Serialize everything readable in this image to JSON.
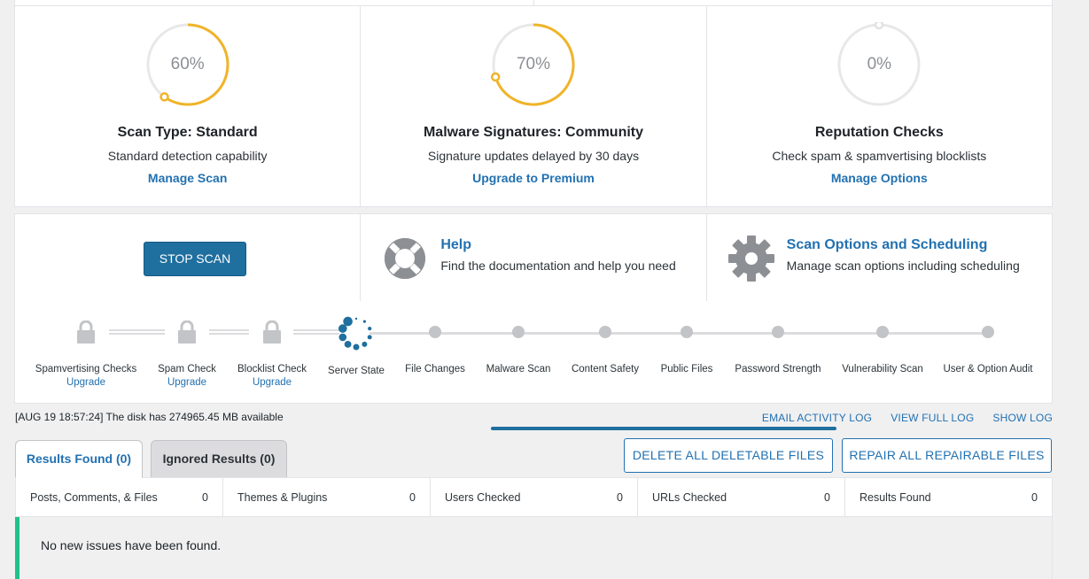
{
  "cards": [
    {
      "percent": "60%",
      "value": 0.6,
      "title": "Scan Type: Standard",
      "subtitle": "Standard detection capability",
      "link": "Manage Scan"
    },
    {
      "percent": "70%",
      "value": 0.7,
      "title": "Malware Signatures: Community",
      "subtitle": "Signature updates delayed by 30 days",
      "link": "Upgrade to Premium"
    },
    {
      "percent": "0%",
      "value": 0.0,
      "title": "Reputation Checks",
      "subtitle": "Check spam & spamvertising blocklists",
      "link": "Manage Options"
    }
  ],
  "actions": {
    "stop_scan": "STOP SCAN",
    "help_title": "Help",
    "help_sub": "Find the documentation and help you need",
    "options_title": "Scan Options and Scheduling",
    "options_sub": "Manage scan options including scheduling"
  },
  "stages": [
    {
      "name": "Spamvertising Checks",
      "upgrade": "Upgrade",
      "state": "locked"
    },
    {
      "name": "Spam Check",
      "upgrade": "Upgrade",
      "state": "locked"
    },
    {
      "name": "Blocklist Check",
      "upgrade": "Upgrade",
      "state": "locked"
    },
    {
      "name": "Server State",
      "state": "running"
    },
    {
      "name": "File Changes",
      "state": "pending"
    },
    {
      "name": "Malware Scan",
      "state": "pending"
    },
    {
      "name": "Content Safety",
      "state": "pending"
    },
    {
      "name": "Public Files",
      "state": "pending"
    },
    {
      "name": "Password Strength",
      "state": "pending"
    },
    {
      "name": "Vulnerability Scan",
      "state": "pending"
    },
    {
      "name": "User & Option Audit",
      "state": "pending"
    }
  ],
  "log": {
    "text": "[AUG 19 18:57:24] The disk has 274965.45 MB available",
    "email": "EMAIL ACTIVITY LOG",
    "full": "VIEW FULL LOG",
    "show": "SHOW LOG",
    "progress": 1.0
  },
  "tabs": {
    "results": "Results Found (0)",
    "ignored": "Ignored Results (0)"
  },
  "buttons": {
    "delete_all": "DELETE ALL DELETABLE FILES",
    "repair_all": "REPAIR ALL REPAIRABLE FILES"
  },
  "stats": [
    {
      "label": "Posts, Comments, & Files",
      "value": "0"
    },
    {
      "label": "Themes & Plugins",
      "value": "0"
    },
    {
      "label": "Users Checked",
      "value": "0"
    },
    {
      "label": "URLs Checked",
      "value": "0"
    },
    {
      "label": "Results Found",
      "value": "0"
    }
  ],
  "notice": "No new issues have been found.",
  "colors": {
    "accent": "#2271b1",
    "gauge": "#f0b429",
    "button": "#1f6f9f",
    "notice_border": "#1ec28b"
  }
}
